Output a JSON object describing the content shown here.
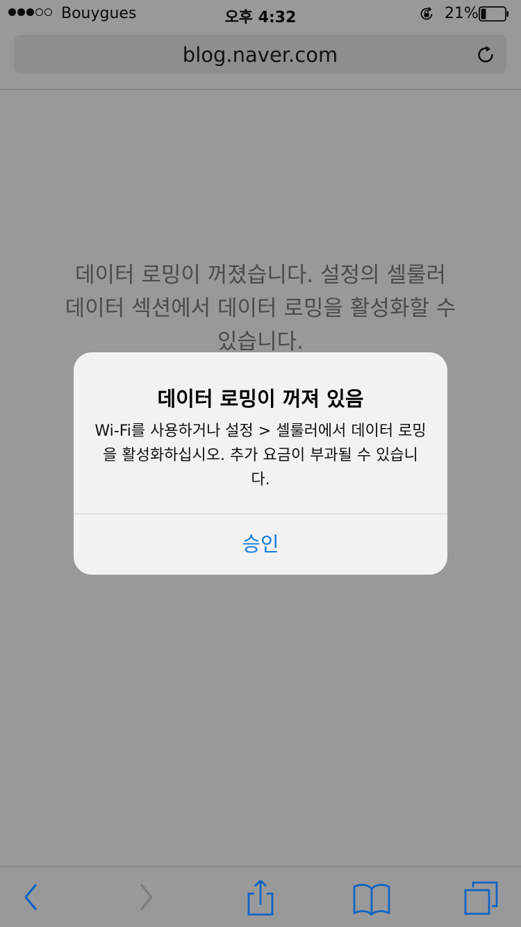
{
  "status_bar": {
    "signal_dots_filled": 3,
    "signal_dots_total": 5,
    "carrier": "Bouygues",
    "time": "오후 4:32",
    "battery_percent_label": "21%",
    "battery_level": 0.21,
    "orientation_lock_icon": "orientation-lock-icon"
  },
  "url_bar": {
    "url": "blog.naver.com",
    "reload_icon": "reload-icon"
  },
  "page": {
    "message": "데이터 로밍이 꺼졌습니다. 설정의 셀룰러 데이터 섹션에서 데이터 로밍을 활성화할 수 있습니다."
  },
  "alert": {
    "title": "데이터 로밍이 꺼져 있음",
    "message": "Wi-Fi를 사용하거나 설정 > 셀룰러에서 데이터 로밍을 활성화하십시오. 추가 요금이 부과될 수 있습니다.",
    "button_label": "승인"
  },
  "toolbar": {
    "back_icon": "back-icon",
    "forward_icon": "forward-icon",
    "share_icon": "share-icon",
    "bookmarks_icon": "bookmarks-icon",
    "tabs_icon": "tabs-icon",
    "active_color": "#1063c4",
    "disabled_color": "#7e7e7e"
  },
  "colors": {
    "dim_background": "#999999",
    "alert_background": "#f2f2f2",
    "accent": "#127ddb"
  }
}
